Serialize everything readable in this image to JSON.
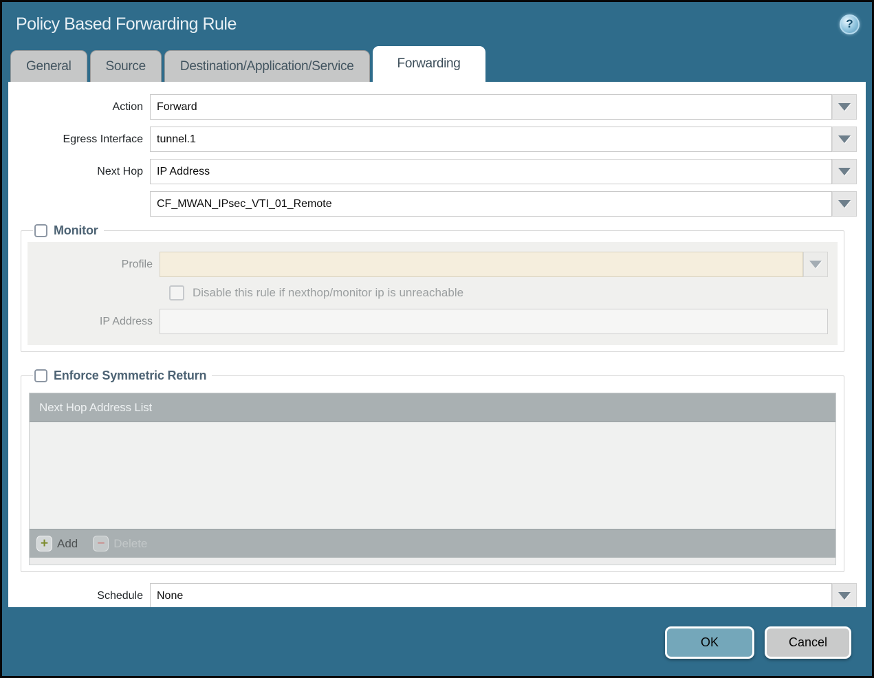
{
  "window": {
    "title": "Policy Based Forwarding Rule"
  },
  "icons": {
    "help": "?",
    "add": "+",
    "delete": "−"
  },
  "tabs": [
    {
      "label": "General",
      "active": false
    },
    {
      "label": "Source",
      "active": false
    },
    {
      "label": "Destination/Application/Service",
      "active": false
    },
    {
      "label": "Forwarding",
      "active": true
    }
  ],
  "form": {
    "action": {
      "label": "Action",
      "value": "Forward"
    },
    "egress_interface": {
      "label": "Egress Interface",
      "value": "tunnel.1"
    },
    "next_hop": {
      "label": "Next Hop",
      "value": "IP Address"
    },
    "next_hop_address": {
      "value": "CF_MWAN_IPsec_VTI_01_Remote"
    },
    "schedule": {
      "label": "Schedule",
      "value": "None"
    }
  },
  "monitor_section": {
    "title": "Monitor",
    "checked": false,
    "profile": {
      "label": "Profile",
      "value": ""
    },
    "disable_rule_checkbox": {
      "label": "Disable this rule if nexthop/monitor ip is unreachable",
      "checked": false
    },
    "ip_address": {
      "label": "IP Address",
      "value": ""
    }
  },
  "symmetric_return_section": {
    "title": "Enforce Symmetric Return",
    "checked": false,
    "table": {
      "header": "Next Hop Address List",
      "rows": []
    },
    "add_button": "Add",
    "delete_button": "Delete"
  },
  "footer": {
    "ok": "OK",
    "cancel": "Cancel"
  },
  "colors": {
    "titlebar_teal": "#2f6c8b",
    "active_tab_bg": "#ffffff",
    "inactive_tab_bg": "#c6c7c7",
    "section_title_text": "#4d6374",
    "disabled_field_cream": "#f5eedd",
    "table_bar_gray": "#a9b0b2",
    "ok_button_teal": "#74a7ba",
    "cancel_button_gray": "#c9caca",
    "add_icon_green": "#7d8c2f",
    "delete_icon_red": "#c98f8f"
  }
}
